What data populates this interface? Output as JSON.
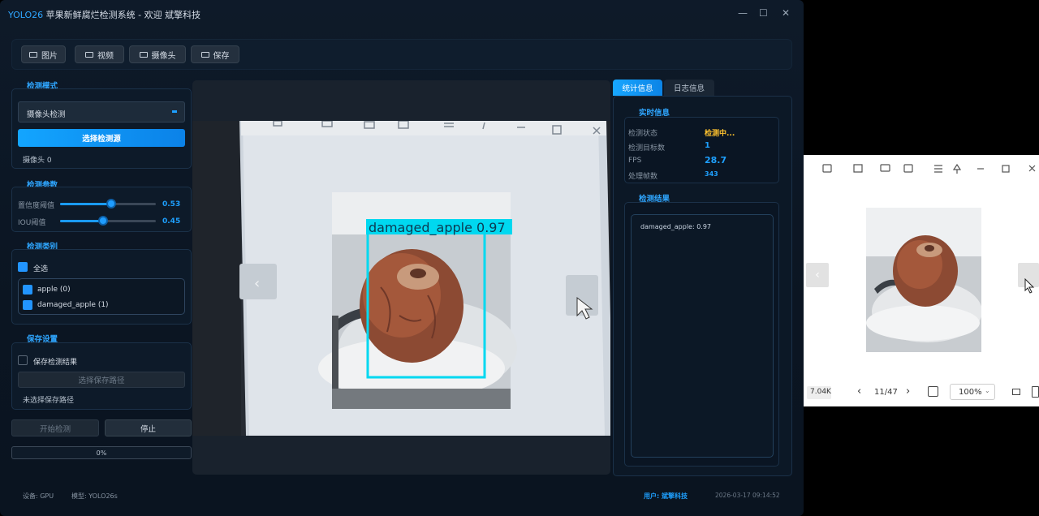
{
  "window": {
    "title_prefix": "YOLO26",
    "title_rest": "苹果新鲜腐烂检测系统 - 欢迎 斌擎科技",
    "controls": [
      "—",
      "☐",
      "✕"
    ]
  },
  "toolbar": {
    "image_label": "图片",
    "video_label": "视频",
    "camera_label": "摄像头",
    "save_label": "保存"
  },
  "detect_mode": {
    "title": "检测模式",
    "selected": "摄像头检测",
    "select_source_label": "选择检测源",
    "source_info": "摄像头 0"
  },
  "params": {
    "title": "检测参数",
    "conf_label": "置信度阈值",
    "conf_value": "0.53",
    "conf_fraction": 0.53,
    "iou_label": "IOU阈值",
    "iou_value": "0.45",
    "iou_fraction": 0.45
  },
  "classes": {
    "title": "检测类别",
    "select_all_label": "全选",
    "items": [
      "apple (0)",
      "damaged_apple (1)"
    ]
  },
  "save_settings": {
    "title": "保存设置",
    "save_result_label": "保存检测结果",
    "choose_path_label": "选择保存路径",
    "path_status": "未选择保存路径"
  },
  "actions": {
    "start_label": "开始检测",
    "stop_label": "停止",
    "progress_text": "0%",
    "progress": 0
  },
  "detection": {
    "label": "damaged_apple",
    "score": "0.97"
  },
  "tabs": {
    "stats_label": "统计信息",
    "log_label": "日志信息"
  },
  "realtime": {
    "title": "实时信息",
    "rows": [
      {
        "label": "检测状态",
        "value": "检测中..."
      },
      {
        "label": "检测目标数",
        "value": "1"
      },
      {
        "label": "FPS",
        "value": "28.7"
      },
      {
        "label": "处理帧数",
        "value": "343"
      }
    ]
  },
  "results": {
    "title": "检测结果",
    "text": "damaged_apple: 0.97"
  },
  "status": {
    "device": "设备: GPU",
    "model": "模型: YOLO26s",
    "user": "用户: 斌擎科技",
    "datetime": "2026-03-17 09:14:52"
  },
  "viewer": {
    "file_size": "7.04K",
    "page": "11/47",
    "zoom": "100%"
  },
  "colors": {
    "accent": "#1ea0ff",
    "status_active": "#ffc22e",
    "bbox": "#00d8f0"
  }
}
